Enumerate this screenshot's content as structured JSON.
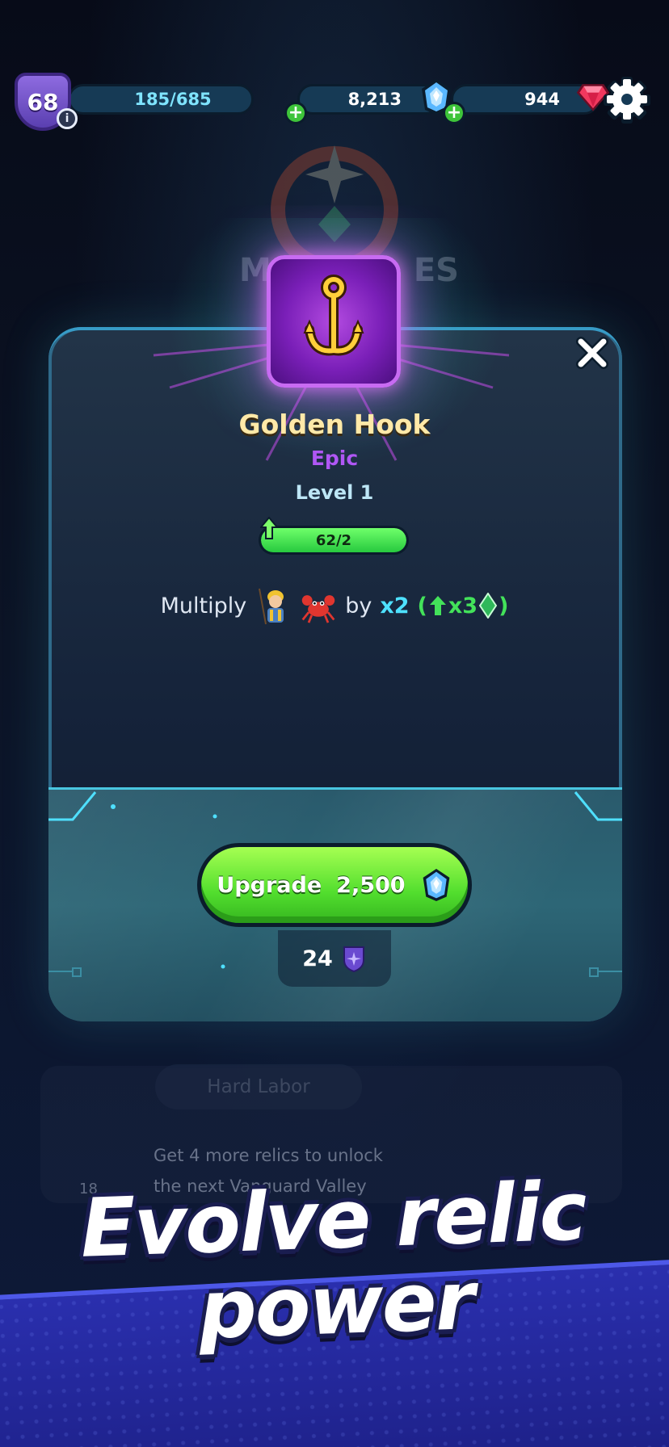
{
  "top_bar": {
    "player_level": "68",
    "xp_progress": "185/685",
    "gems": "8,213",
    "rubies": "944"
  },
  "background": {
    "faded_title": "M",
    "faded_title_tail": "ES",
    "faded_tab": "Hard Labor",
    "faded_unlock_text_line1": "Get 4 more relics to unlock",
    "faded_unlock_text_line2": "the next Vanguard Valley",
    "faded_badge_count": "18"
  },
  "relic_popup": {
    "name": "Golden Hook",
    "rarity": "Epic",
    "level_text": "Level 1",
    "progress_text": "62/2",
    "progress_fraction": 1.0,
    "effect": {
      "prefix": "Multiply",
      "by": "by",
      "multiplier": "x2",
      "open_paren": "(",
      "bonus": "x3",
      "close_paren": ")"
    },
    "upgrade_label": "Upgrade",
    "upgrade_cost": "2,500",
    "shard_count": "24"
  },
  "banner": {
    "line1": "Evolve relic",
    "line2": "power"
  },
  "colors": {
    "rarity_epic": "#b057f5",
    "relic_name": "#ffe9a8",
    "upgrade_button": "#52de2e",
    "multiplier": "#4ee1ff",
    "bonus_green": "#43e25a",
    "banner_blue": "#2a2fae"
  },
  "icons": {
    "relic": "golden-hook-icon",
    "gem": "blue-gem-icon",
    "ruby": "red-ruby-icon",
    "settings": "gear-icon",
    "close": "close-icon",
    "shard": "purple-shard-icon",
    "fisherman": "fisherman-icon",
    "crab": "crab-icon",
    "level_up_arrow": "up-arrow-icon"
  }
}
